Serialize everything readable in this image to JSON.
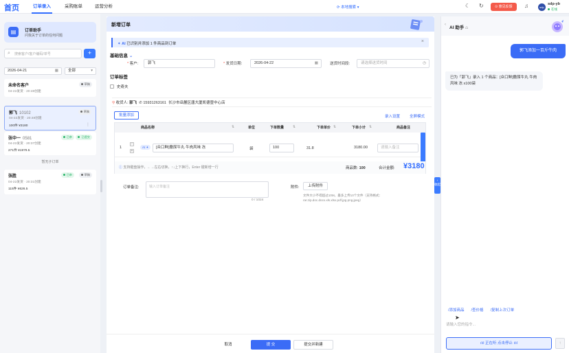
{
  "nav": {
    "brand": "首页",
    "tabs": [
      "订单录入",
      "采购账单",
      "运营分析"
    ],
    "search": "本地搜索",
    "feedback": "意见反馈",
    "user": {
      "name": "sdp-yb",
      "status": "在线",
      "avatar": "sdp"
    }
  },
  "sidebar": {
    "assistant": {
      "title": "订单助手",
      "subtitle": "问我关于订单的任何问题"
    },
    "search_placeholder": "搜索客户/客户编码/单号",
    "date": "2026-04-21",
    "filter": "全部",
    "orders": [
      {
        "name": "未命名客户",
        "code": "",
        "meta": "04-22发货 · 20:48创建",
        "amount": "",
        "badges": [
          {
            "text": "草稿",
            "type": "gray"
          }
        ]
      },
      {
        "name": "郭飞",
        "code": "10102",
        "meta": "04-22发货 · 20:48创建",
        "amount": "100件 ¥3180",
        "badges": [
          {
            "text": "草稿",
            "type": "gray"
          }
        ]
      },
      {
        "name": "张中一",
        "code": "0581",
        "meta": "04-22发货 · 20:37创建",
        "amount": "271件 ¥1979.5",
        "badges": [
          {
            "text": "已审",
            "type": "green"
          },
          {
            "text": "已提交",
            "type": "green"
          }
        ]
      },
      {
        "name": "张胜",
        "code": "",
        "meta": "04-22发货 · 20:31创建",
        "amount": "115件 ¥626.5",
        "badges": [
          {
            "text": "已审",
            "type": "green"
          },
          {
            "text": "草稿",
            "type": "gray"
          }
        ]
      }
    ],
    "group_label": "暂无子订单"
  },
  "main": {
    "title": "新增订单",
    "ai_banner": {
      "prefix": "AI",
      "text": "已识别并添加 1 件商品到订单"
    },
    "basic_section": "基础信息",
    "fields": {
      "customer_label": "客户:",
      "customer": "郭飞",
      "date_label": "发货日期:",
      "date": "2026-04-22",
      "period_label": "送货时间段:",
      "period_placeholder": "请选择送货时间"
    },
    "tags_section": "订单标签",
    "tag_option": "史奇夫",
    "address": {
      "receiver_label": "收货人:",
      "receiver": "郭飞",
      "phone": "15931263161",
      "addr": "长沙市岳麓区唐大厦凯德壹中心店"
    },
    "batch_add": "批量添加",
    "links": {
      "setting": "录入设置",
      "fullscreen": "全屏模式"
    },
    "table": {
      "headers": [
        "商品名称",
        "单位",
        "下单数量",
        "下单单价",
        "下单小计",
        "商品备注"
      ],
      "row": {
        "index": "1",
        "ai_tag": "AI",
        "name": "[众口鲜]撒尿牛丸 牛肉风味 冻",
        "unit": "袋",
        "qty": "100",
        "price": "31.8",
        "subtotal": "3180.00",
        "remark_placeholder": "请输入备注"
      },
      "hint": "支持键盘操作，←→左右切换，↑↓上下换行，Enter 键新增一行",
      "qty_total_label": "商品数:",
      "qty_total": "100",
      "amount_label": "合计金额:",
      "amount": "¥3180"
    },
    "remark": {
      "label": "订单备注:",
      "placeholder": "输入订单备注",
      "count": "0 / 1024"
    },
    "attach": {
      "label": "附件:",
      "button": "上传附件",
      "note": "文件大小不得超过10M，最多上传10个文件（支持格式：rar.zip.doc.docx.xls.xlsx.pdf.jpg.png.jpeg）"
    },
    "footer": {
      "cancel": "取消",
      "submit": "提 交",
      "submit_new": "提交并新建"
    }
  },
  "panel_toggle": "收起",
  "ai_panel": {
    "title": "AI 助手",
    "user_msg": "郭飞添加一百斤牛肉",
    "bot_msg": "已为「郭飞」录入 1 个商品：[众口鲜]撒尿牛丸 牛肉风味 冻 x100袋",
    "quick": [
      "/添加商品",
      "/查价格",
      "/复制上次订单"
    ],
    "input_placeholder": "请输入您的指令...",
    "voice": "正在听 点击停止"
  },
  "colors": {
    "accent": "#3b6cf6",
    "brand": "#2f6bff",
    "danger": "#f45a4a",
    "success": "#2bb66b"
  }
}
